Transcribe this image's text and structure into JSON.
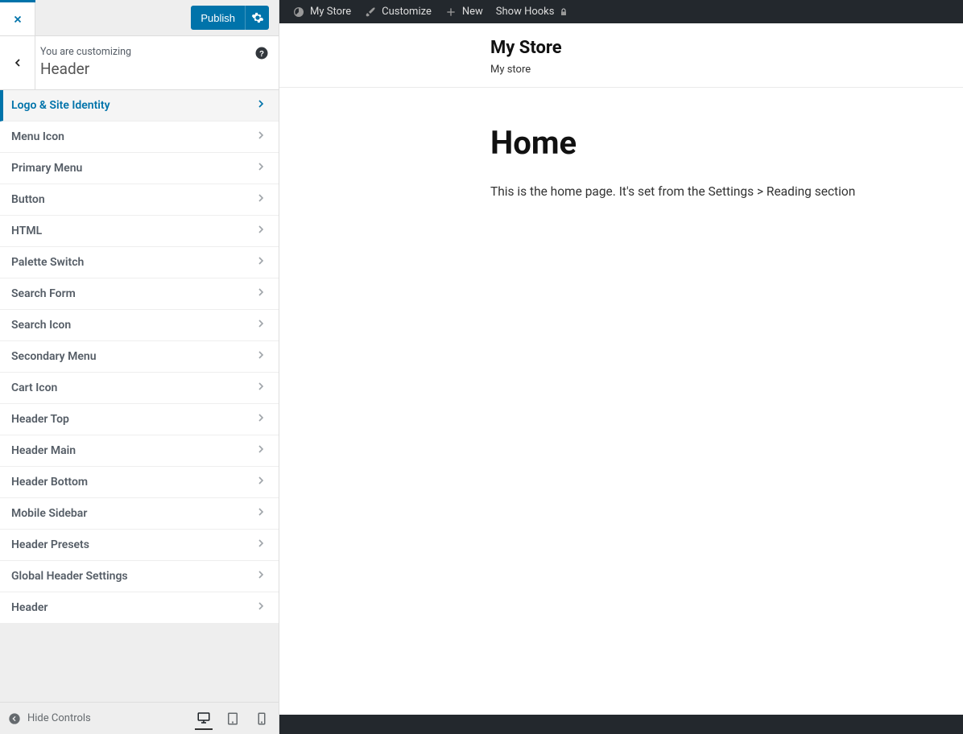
{
  "panel": {
    "publish_label": "Publish",
    "subhead": "You are customizing",
    "section_title": "Header",
    "items": [
      {
        "label": "Logo & Site Identity",
        "active": true
      },
      {
        "label": "Menu Icon"
      },
      {
        "label": "Primary Menu"
      },
      {
        "label": "Button"
      },
      {
        "label": "HTML"
      },
      {
        "label": "Palette Switch"
      },
      {
        "label": "Search Form"
      },
      {
        "label": "Search Icon"
      },
      {
        "label": "Secondary Menu"
      },
      {
        "label": "Cart Icon"
      },
      {
        "label": "Header Top"
      },
      {
        "label": "Header Main"
      },
      {
        "label": "Header Bottom"
      },
      {
        "label": "Mobile Sidebar"
      },
      {
        "label": "Header Presets"
      },
      {
        "label": "Global Header Settings"
      },
      {
        "label": "Header"
      }
    ],
    "hide_controls_label": "Hide Controls"
  },
  "adminbar": {
    "site_name": "My Store",
    "customize": "Customize",
    "new": "New",
    "show_hooks": "Show Hooks"
  },
  "preview": {
    "site_title": "My Store",
    "site_tagline": "My store",
    "page_title": "Home",
    "page_body": "This is the home page. It's set from the Settings > Reading section"
  }
}
